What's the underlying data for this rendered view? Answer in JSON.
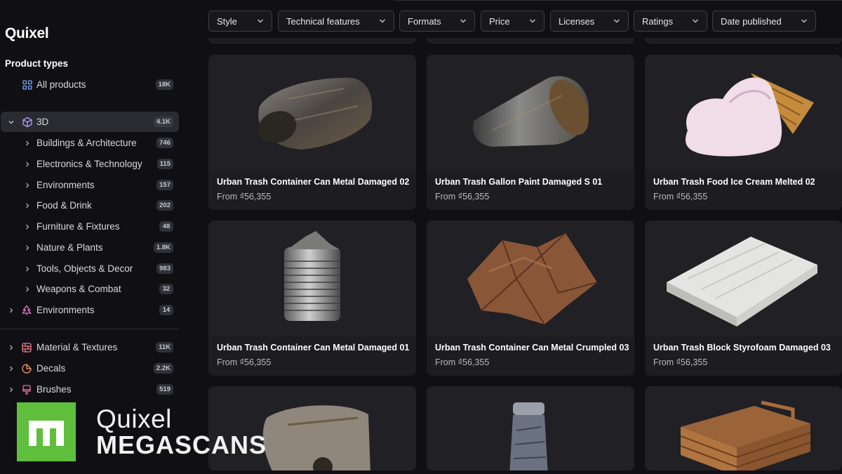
{
  "sidebar": {
    "brand": "Quixel",
    "section_title": "Product types",
    "all_products": {
      "label": "All products",
      "count": "18K"
    },
    "category_3d": {
      "label": "3D",
      "count": "4.1K"
    },
    "sub_items": [
      {
        "label": "Buildings & Architecture",
        "count": "746"
      },
      {
        "label": "Electronics & Technology",
        "count": "115"
      },
      {
        "label": "Environments",
        "count": "157"
      },
      {
        "label": "Food & Drink",
        "count": "202"
      },
      {
        "label": "Furniture & Fixtures",
        "count": "48"
      },
      {
        "label": "Nature & Plants",
        "count": "1.8K"
      },
      {
        "label": "Tools, Objects & Decor",
        "count": "983"
      },
      {
        "label": "Weapons & Combat",
        "count": "32"
      }
    ],
    "environments": {
      "label": "Environments",
      "count": "14"
    },
    "materials": {
      "label": "Material & Textures",
      "count": "11K"
    },
    "decals": {
      "label": "Decals",
      "count": "2.2K"
    },
    "brushes": {
      "label": "Brushes",
      "count": "519"
    }
  },
  "filters": [
    {
      "label": "Style"
    },
    {
      "label": "Technical features"
    },
    {
      "label": "Formats"
    },
    {
      "label": "Price"
    },
    {
      "label": "Licenses"
    },
    {
      "label": "Ratings"
    },
    {
      "label": "Date published"
    }
  ],
  "products": [
    {
      "title": "Urban Trash Container Can Metal Damaged 02",
      "price": "From ₫56,355"
    },
    {
      "title": "Urban Trash Gallon Paint Damaged S 01",
      "price": "From ₫56,355"
    },
    {
      "title": "Urban Trash Food Ice Cream Melted 02",
      "price": "From ₫56,355"
    },
    {
      "title": "Urban Trash Container Can Metal Damaged 01",
      "price": "From ₫56,355"
    },
    {
      "title": "Urban Trash Container Can Metal Crumpled 03",
      "price": "From ₫56,355"
    },
    {
      "title": "Urban Trash Block Styrofoam Damaged 03",
      "price": "From ₫56,355"
    }
  ],
  "watermark": {
    "line1": "Quixel",
    "line2": "MEGASCANS"
  },
  "colors": {
    "accent_green": "#5fbf3c",
    "background": "#101014",
    "card": "#1c1c21"
  }
}
